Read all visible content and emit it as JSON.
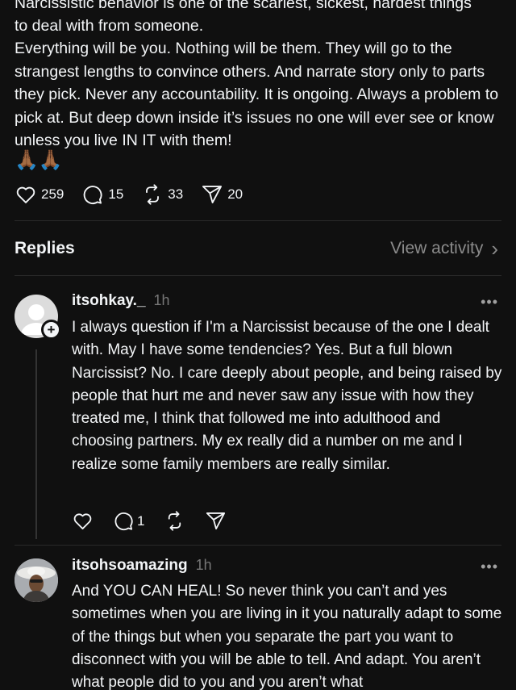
{
  "post": {
    "text_cut_line": "Narcissistic behavior is one of the scariest, sickest, hardest things",
    "text_line1": "to deal with from someone.",
    "text_paragraph": "Everything will be you. Nothing will be them. They will go to the strangest lengths to convince others. And narrate story only to parts they pick. Never any accountability. It is ongoing. Always a problem to pick at. But deep down inside it’s issues no one will ever see or know unless you live IN IT with them!",
    "emoji": "🙏🏾🙏🏾",
    "likes": "259",
    "comments": "15",
    "reposts": "33",
    "shares": "20"
  },
  "replies_header": {
    "title": "Replies",
    "view_activity": "View activity",
    "chevron": "›"
  },
  "replies": [
    {
      "username": "itsohkay._",
      "time": "1h",
      "more": "•••",
      "plus": "+",
      "text": "I always question if I'm a Narcissist because of the one I dealt with. May I have some tendencies? Yes. But a full blown Narcissist? No. I care deeply about people, and being raised by people that hurt me and never saw any issue with how they treated me, I think that followed me into adulthood and choosing partners. My ex really did a number on me and I realize some family members are really similar.",
      "comments": "1"
    },
    {
      "username": "itsohsoamazing",
      "time": "1h",
      "more": "•••",
      "text": "And YOU CAN HEAL! So never think you can’t and yes sometimes when you are living in it you naturally adapt to some of the things but when you separate the part you want to disconnect with you will be able to tell. And adapt. You aren’t what people did to you and you aren’t what"
    }
  ],
  "icons": {
    "like": "heart-icon",
    "comment": "comment-bubble-icon",
    "repost": "repost-icon",
    "share": "share-paper-plane-icon",
    "more": "more-dots-icon",
    "chevron": "chevron-right-icon"
  },
  "colors": {
    "background": "#101010",
    "text": "#f3f5f7",
    "muted": "#777777",
    "divider": "#2a2a2a"
  }
}
